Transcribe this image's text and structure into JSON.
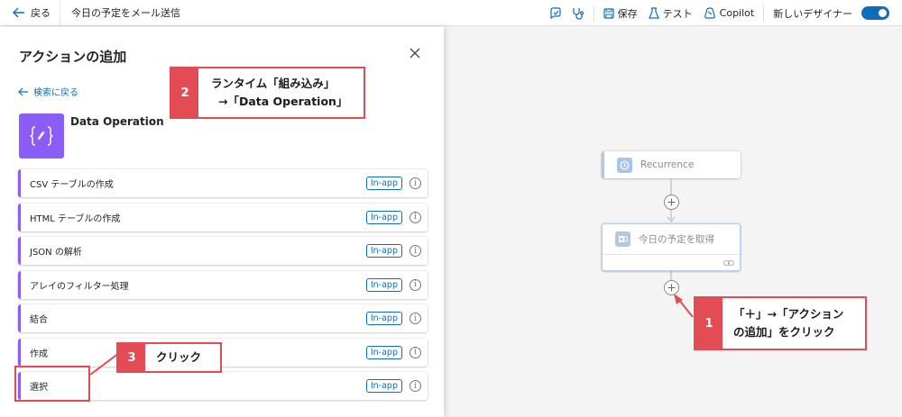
{
  "topbar": {
    "back_label": "戻る",
    "flow_title": "今日の予定をメール送信",
    "save_label": "保存",
    "test_label": "テスト",
    "copilot_label": "Copilot",
    "new_designer_label": "新しいデザイナー"
  },
  "panel": {
    "title": "アクションの追加",
    "back_to_search": "検索に戻る",
    "connector_name": "Data Operation",
    "actions": [
      {
        "label": "CSV テーブルの作成",
        "badge": "In-app"
      },
      {
        "label": "HTML テーブルの作成",
        "badge": "In-app"
      },
      {
        "label": "JSON の解析",
        "badge": "In-app"
      },
      {
        "label": "アレイのフィルター処理",
        "badge": "In-app"
      },
      {
        "label": "結合",
        "badge": "In-app"
      },
      {
        "label": "作成",
        "badge": "In-app"
      },
      {
        "label": "選択",
        "badge": "In-app"
      }
    ]
  },
  "canvas": {
    "node1_label": "Recurrence",
    "node2_label": "今日の予定を取得"
  },
  "annotations": {
    "a1": {
      "num": "1",
      "line1": "「＋」→「アクション",
      "line2": "の追加」をクリック"
    },
    "a2": {
      "num": "2",
      "line1": "ランタイム「組み込み」",
      "line2": "→「Data Operation」"
    },
    "a3": {
      "num": "3",
      "line1": "クリック"
    }
  },
  "colors": {
    "accent": "#0f6cbd",
    "data_operation": "#8b5cf6",
    "annotation": "#e34c55"
  }
}
